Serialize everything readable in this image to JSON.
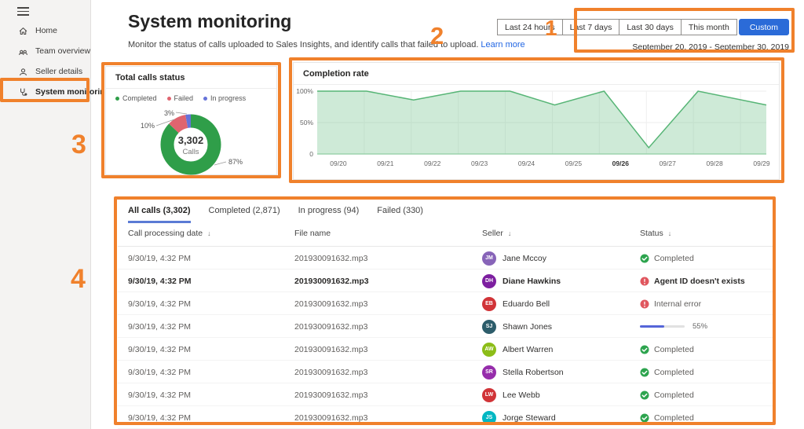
{
  "sidebar": {
    "items": [
      {
        "label": "Home",
        "icon": "home-icon",
        "active": false
      },
      {
        "label": "Team overview",
        "icon": "team-icon",
        "active": false
      },
      {
        "label": "Seller details",
        "icon": "person-icon",
        "active": false
      },
      {
        "label": "System monitoring",
        "icon": "stethoscope-icon",
        "active": true
      }
    ]
  },
  "header": {
    "title": "System monitoring",
    "subtitle": "Monitor the status of calls uploaded to Sales Insights, and identify calls that failed to upload.",
    "learn_more": "Learn more"
  },
  "time_range": {
    "buttons": [
      "Last 24 hours",
      "Last 7 days",
      "Last 30 days",
      "This month",
      "Custom"
    ],
    "selected": "Custom",
    "date_range": "September 20, 2019 - September 30, 2019"
  },
  "chart_data": [
    {
      "type": "pie",
      "title": "Total calls status",
      "legend": [
        "Completed",
        "Failed",
        "In progress"
      ],
      "slices": [
        {
          "label": "Completed",
          "value_pct": 87,
          "callout": "87%",
          "color": "#2f9e49"
        },
        {
          "label": "Failed",
          "value_pct": 10,
          "callout": "10%",
          "color": "#e0646f"
        },
        {
          "label": "In progress",
          "value_pct": 3,
          "callout": "3%",
          "color": "#6673d9"
        }
      ],
      "center_value": "3,302",
      "center_label": "Calls"
    },
    {
      "type": "area",
      "title": "Completion rate",
      "x_labels": [
        "09/20",
        "09/21",
        "09/22",
        "09/23",
        "09/24",
        "09/25",
        "09/26",
        "09/27",
        "09/28",
        "09/29"
      ],
      "bold_x_label": "09/26",
      "y_ticks": [
        {
          "label": "100%",
          "value": 100
        },
        {
          "label": "50%",
          "value": 50
        },
        {
          "label": "0",
          "value": 0
        }
      ],
      "ylim": [
        0,
        100
      ],
      "points": [
        {
          "x": -0.45,
          "y": 100
        },
        {
          "x": 0.6,
          "y": 100
        },
        {
          "x": 1.6,
          "y": 86
        },
        {
          "x": 2.6,
          "y": 100
        },
        {
          "x": 3.65,
          "y": 100
        },
        {
          "x": 4.6,
          "y": 78
        },
        {
          "x": 5.65,
          "y": 100
        },
        {
          "x": 6.6,
          "y": 10
        },
        {
          "x": 7.65,
          "y": 100
        },
        {
          "x": 9.1,
          "y": 78
        }
      ],
      "line_color": "#57b576",
      "fill_color": "rgba(125,199,150,0.38)"
    }
  ],
  "table": {
    "tabs": [
      {
        "label": "All calls (3,302)",
        "active": true
      },
      {
        "label": "Completed (2,871)",
        "active": false
      },
      {
        "label": "In progress (94)",
        "active": false
      },
      {
        "label": "Failed (330)",
        "active": false
      }
    ],
    "columns": [
      {
        "label": "Call processing date",
        "sort": true
      },
      {
        "label": "File name",
        "sort": false
      },
      {
        "label": "Seller",
        "sort": true
      },
      {
        "label": "Status",
        "sort": true
      }
    ],
    "sort_icon": "↓",
    "rows": [
      {
        "date": "9/30/19, 4:32 PM",
        "file": "201930091632.mp3",
        "seller": "Jane Mccoy",
        "initials": "JM",
        "avatar_color": "#8764b8",
        "bold": false,
        "status": {
          "kind": "completed",
          "label": "Completed"
        }
      },
      {
        "date": "9/30/19, 4:32 PM",
        "file": "201930091632.mp3",
        "seller": "Diane Hawkins",
        "initials": "DH",
        "avatar_color": "#7d1fa0",
        "bold": true,
        "status": {
          "kind": "error",
          "label": "Agent ID doesn't exists"
        }
      },
      {
        "date": "9/30/19, 4:32 PM",
        "file": "201930091632.mp3",
        "seller": "Eduardo Bell",
        "initials": "EB",
        "avatar_color": "#d13438",
        "bold": false,
        "status": {
          "kind": "error",
          "label": "Internal error"
        }
      },
      {
        "date": "9/30/19, 4:32 PM",
        "file": "201930091632.mp3",
        "seller": "Shawn Jones",
        "initials": "SJ",
        "avatar_color": "#2d5d6b",
        "bold": false,
        "status": {
          "kind": "progress",
          "label": "55%",
          "pct": 55
        }
      },
      {
        "date": "9/30/19, 4:32 PM",
        "file": "201930091632.mp3",
        "seller": "Albert Warren",
        "initials": "AW",
        "avatar_color": "#8cbd18",
        "bold": false,
        "status": {
          "kind": "completed",
          "label": "Completed"
        }
      },
      {
        "date": "9/30/19, 4:32 PM",
        "file": "201930091632.mp3",
        "seller": "Stella Robertson",
        "initials": "SR",
        "avatar_color": "#962dab",
        "bold": false,
        "status": {
          "kind": "completed",
          "label": "Completed"
        }
      },
      {
        "date": "9/30/19, 4:32 PM",
        "file": "201930091632.mp3",
        "seller": "Lee Webb",
        "initials": "LW",
        "avatar_color": "#d13438",
        "bold": false,
        "status": {
          "kind": "completed",
          "label": "Completed"
        }
      },
      {
        "date": "9/30/19, 4:32 PM",
        "file": "201930091632.mp3",
        "seller": "Jorge Steward",
        "initials": "JS",
        "avatar_color": "#00b7c3",
        "bold": false,
        "status": {
          "kind": "completed",
          "label": "Completed"
        }
      }
    ],
    "status_colors": {
      "completed": "#2da44e",
      "error": "#e0565e",
      "progress": "#5565d8"
    }
  },
  "annotations": {
    "color": "#f0812c",
    "numbers": [
      "1",
      "2",
      "3",
      "4"
    ]
  }
}
